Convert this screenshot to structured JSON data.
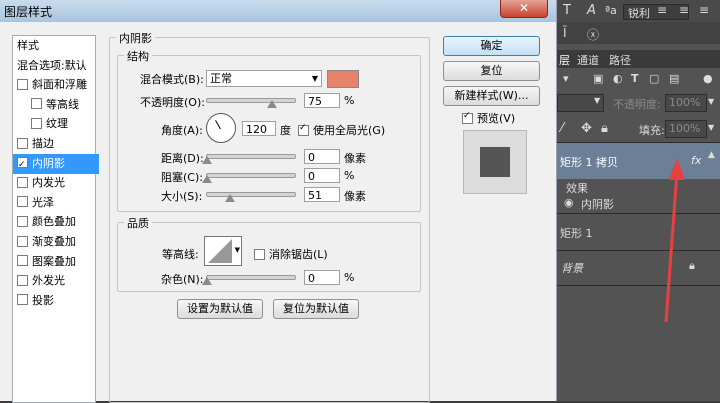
{
  "dialog": {
    "title": "图层样式",
    "close": "✕",
    "style_list": [
      {
        "label": "样式",
        "type": "header"
      },
      {
        "label": "混合选项:默认",
        "type": "header"
      },
      {
        "label": "斜面和浮雕",
        "checked": false
      },
      {
        "label": "等高线",
        "checked": false,
        "indent": true
      },
      {
        "label": "纹理",
        "checked": false,
        "indent": true
      },
      {
        "label": "描边",
        "checked": false
      },
      {
        "label": "内阴影",
        "checked": true,
        "selected": true
      },
      {
        "label": "内发光",
        "checked": false
      },
      {
        "label": "光泽",
        "checked": false
      },
      {
        "label": "颜色叠加",
        "checked": false
      },
      {
        "label": "渐变叠加",
        "checked": false
      },
      {
        "label": "图案叠加",
        "checked": false
      },
      {
        "label": "外发光",
        "checked": false
      },
      {
        "label": "投影",
        "checked": false
      }
    ],
    "section_title": "内阴影",
    "structure": {
      "group_label": "结构",
      "blend_mode_label": "混合模式(B):",
      "blend_mode_value": "正常",
      "shadow_color": "#e8826a",
      "opacity_label": "不透明度(O):",
      "opacity_value": "75",
      "opacity_pct": 75,
      "percent": "%",
      "angle_label": "角度(A):",
      "angle_value": "120",
      "degree": "度",
      "global_light_label": "使用全局光(G)",
      "distance_label": "距离(D):",
      "distance_value": "0",
      "distance_unit": "像素",
      "choke_label": "阻塞(C):",
      "choke_value": "0",
      "choke_unit": "%",
      "size_label": "大小(S):",
      "size_value": "51",
      "size_unit": "像素"
    },
    "quality": {
      "group_label": "品质",
      "contour_label": "等高线:",
      "antialias_label": "消除锯齿(L)",
      "noise_label": "杂色(N):",
      "noise_value": "0",
      "noise_unit": "%"
    },
    "set_default": "设置为默认值",
    "reset_default": "复位为默认值",
    "buttons": {
      "ok": "确定",
      "reset": "复位",
      "new_style": "新建样式(W)...",
      "preview": "预览(V)"
    }
  },
  "panel": {
    "font_sample": "锐利",
    "tabs": [
      "层",
      "通道",
      "路径"
    ],
    "opacity_label": "不透明度:",
    "opacity_value": "100%",
    "fill_label": "填充:",
    "fill_value": "100%",
    "layers": [
      {
        "name": "矩形 1 拷贝",
        "fx": "fx"
      },
      {
        "name": "效果"
      },
      {
        "name": "内阴影"
      },
      {
        "name": "矩形 1"
      },
      {
        "name": "背景"
      }
    ],
    "colors": {
      "selected_layer": "#6b7f96",
      "arrow": "#e84040"
    }
  }
}
